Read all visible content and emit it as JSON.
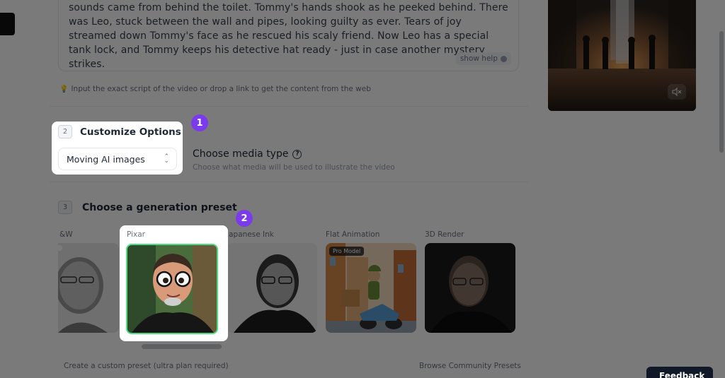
{
  "script": {
    "text": "sounds came from behind the toilet. Tommy's hands shook as he peeked behind. There was Leo, stuck between the wall and pipes, looking guilty as ever. Tears of joy streamed down Tommy's face as he rescued his scaly friend. Now Leo has a special tank lock, and Tommy keeps his detective hat ready - just in case another mystery strikes.",
    "show_help": "show help",
    "hint": "Input the exact script of the video or drop a link to get the content from the web"
  },
  "step2": {
    "number": "2",
    "title": "Customize Options",
    "select_value": "Moving AI images",
    "media_title": "Choose media type",
    "media_subtitle": "Choose what media will be used to illustrate the video"
  },
  "step3": {
    "number": "3",
    "title": "Choose a generation preset",
    "presets": [
      {
        "label": "B&W",
        "label_visible": "&W"
      },
      {
        "label": "Pixar"
      },
      {
        "label": "Japanese Ink",
        "label_visible": "Japanese Ink"
      },
      {
        "label": "Flat Animation",
        "tag": "Pro Model"
      },
      {
        "label": "3D Render"
      }
    ],
    "create_custom": "Create a custom preset (ultra plan required)",
    "browse_community": "Browse Community Presets"
  },
  "markers": [
    "1",
    "2"
  ],
  "feedback": "Feedback",
  "colors": {
    "accent_marker": "#7c3aed",
    "selected_border": "#4ade80",
    "overlay": "rgba(0,0,0,0.52)"
  }
}
